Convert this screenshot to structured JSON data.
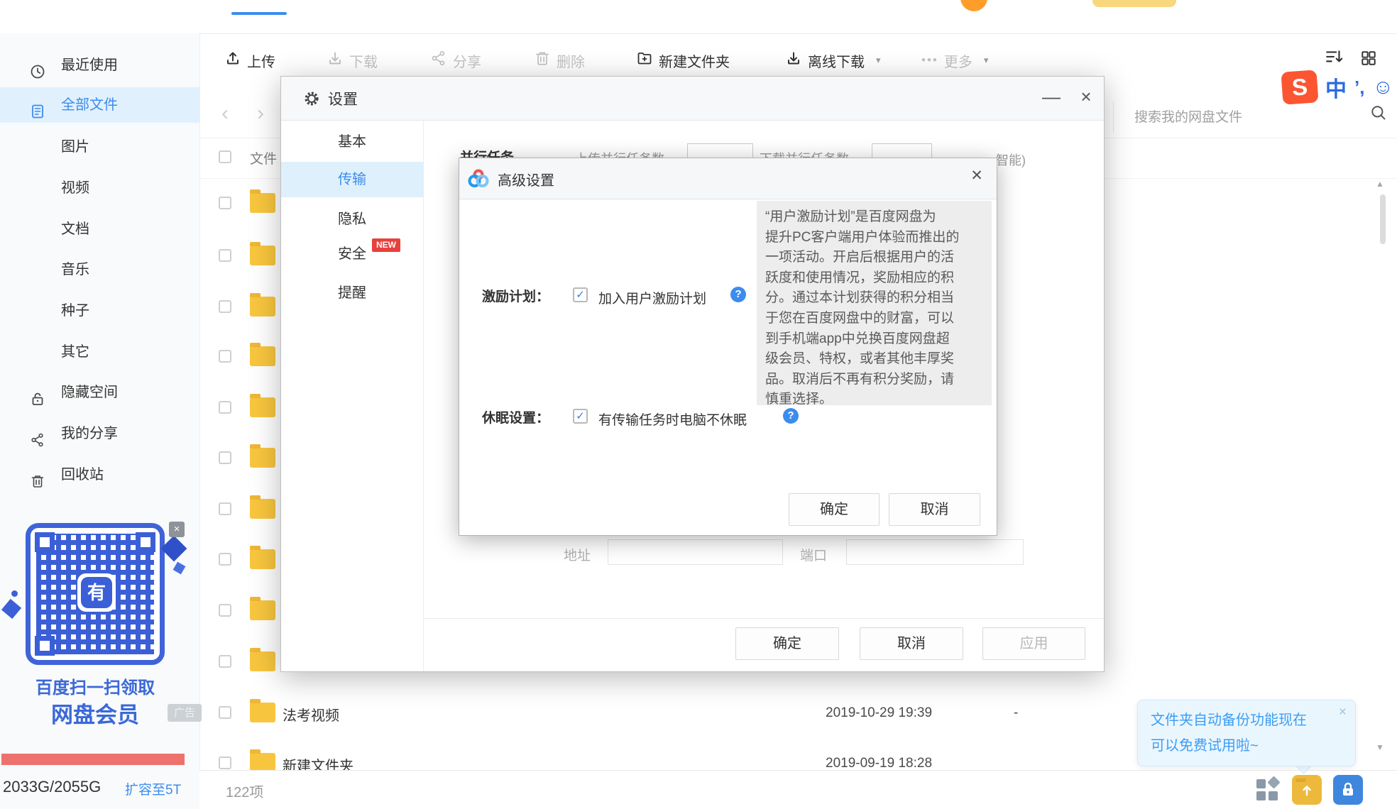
{
  "colors": {
    "accent": "#3b8cee",
    "selected_bg": "#e1f0fd",
    "folder_yellow": "#f8c63e",
    "storage_bar_red": "#ee716e",
    "qr_blue": "#3b5fd7",
    "new_badge_red": "#e8413c",
    "sogou_orange": "#fc5531",
    "notification_blue": "#3d9df3"
  },
  "ime_bar": {
    "logo": "S",
    "lang": "中",
    "punct": "’,",
    "smiley": "☺"
  },
  "toolbar": {
    "items": [
      {
        "label": "上传",
        "icon": "upload-icon",
        "enabled": true
      },
      {
        "label": "下载",
        "icon": "download-icon",
        "enabled": false
      },
      {
        "label": "分享",
        "icon": "share-icon",
        "enabled": false
      },
      {
        "label": "删除",
        "icon": "trash-icon",
        "enabled": false
      },
      {
        "label": "新建文件夹",
        "icon": "new-folder-icon",
        "enabled": true
      },
      {
        "label": "离线下载",
        "icon": "offline-download-icon",
        "enabled": true,
        "has_dropdown": true
      },
      {
        "label": "更多",
        "icon": "more-dots-icon",
        "enabled": false,
        "has_dropdown": true
      }
    ]
  },
  "search": {
    "placeholder": "搜索我的网盘文件"
  },
  "sidebar": {
    "items": [
      {
        "label": "最近使用",
        "icon": "clock-icon"
      },
      {
        "label": "全部文件",
        "icon": "file-icon",
        "selected": true
      },
      {
        "label": "图片"
      },
      {
        "label": "视频"
      },
      {
        "label": "文档"
      },
      {
        "label": "音乐"
      },
      {
        "label": "种子"
      },
      {
        "label": "其它"
      },
      {
        "label": "隐藏空间",
        "icon": "lock-icon"
      },
      {
        "label": "我的分享",
        "icon": "share-nodes-icon"
      },
      {
        "label": "回收站",
        "icon": "trash-icon"
      }
    ]
  },
  "promo": {
    "qr_center_glyph": "有",
    "caption_line1": "百度扫一扫领取",
    "caption_line2": "网盘会员",
    "ad_badge": "广告"
  },
  "storage": {
    "usage": "2033G/2055G",
    "upgrade_link": "扩容至5T"
  },
  "file_list": {
    "header_label": "文件",
    "rows": [
      {
        "name": "法考视频",
        "modified": "2019-10-29 19:39",
        "size": "-"
      },
      {
        "name": "新建文件夹",
        "modified": "2019-09-19 18:28",
        "size": ""
      }
    ]
  },
  "status_bar": {
    "item_count": "122项"
  },
  "settings_dialog": {
    "title": "设置",
    "tabs": [
      {
        "label": "基本"
      },
      {
        "label": "传输",
        "selected": true
      },
      {
        "label": "隐私"
      },
      {
        "label": "安全",
        "badge": "NEW"
      },
      {
        "label": "提醒"
      }
    ],
    "content_fragments": {
      "parallel_section": "并行任务",
      "upload_parallel_label": "上传并行任务数",
      "download_parallel_label": "下载并行任务数",
      "smart_hint": "智能)",
      "address_label": "地址",
      "port_label": "端口"
    },
    "footer": {
      "ok": "确定",
      "cancel": "取消",
      "apply": "应用"
    }
  },
  "advanced_dialog": {
    "title": "高级设置",
    "incentive": {
      "label": "激励计划：",
      "checkbox_label": "加入用户激励计划",
      "checked": true,
      "tooltip": "“用户激励计划”是百度网盘为\n提升PC客户端用户体验而推出的\n一项活动。开启后根据用户的活\n跃度和使用情况，奖励相应的积\n分。通过本计划获得的积分相当\n于您在百度网盘中的财富，可以\n到手机端app中兑换百度网盘超\n级会员、特权，或者其他丰厚奖\n品。取消后不再有积分奖励，请\n慎重选择。"
    },
    "sleep": {
      "label": "休眠设置：",
      "checkbox_label": "有传输任务时电脑不休眠",
      "checked": true
    },
    "footer": {
      "ok": "确定",
      "cancel": "取消"
    }
  },
  "notification": {
    "text": "文件夹自动备份功能现在\n可以免费试用啦~"
  },
  "icons": {
    "minimize": "—",
    "close": "×",
    "dialog_close": "✕",
    "dropdown_caret": "▾",
    "more_dots": "•••",
    "back": "‹",
    "forward": "›",
    "scroll_up": "▲",
    "scroll_down": "▼",
    "help": "?",
    "check": "✓",
    "promo_close": "×",
    "notification_close": "×"
  }
}
